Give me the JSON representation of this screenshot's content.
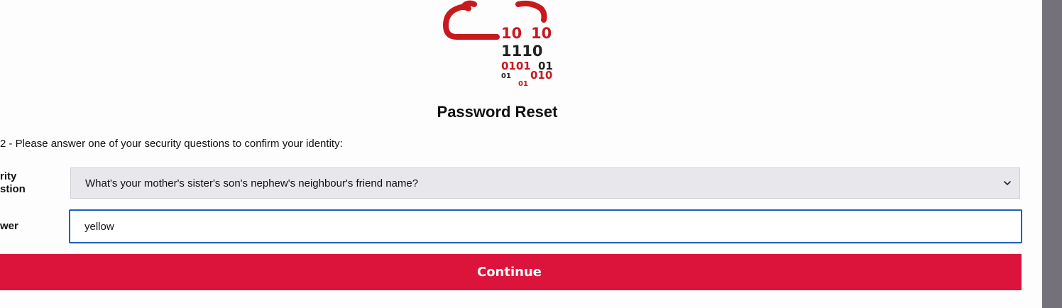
{
  "logo": {
    "binary_lines": [
      "10",
      "10",
      "1110",
      "0101",
      "01",
      "01",
      "010",
      "01"
    ],
    "colors": {
      "primary_red": "#c8191e",
      "dark": "#222222"
    }
  },
  "title": "Password Reset",
  "step_text": "2 - Please answer one of your security questions to confirm your identity:",
  "form": {
    "question_label": "rity\nstion",
    "question_selected": "What's your mother's sister's son's nephew's neighbour's friend name?",
    "answer_label": "wer",
    "answer_value": "yellow"
  },
  "continue_label": "Continue",
  "colors": {
    "button": "#dc143c",
    "focus_border": "#1e5fbf",
    "select_bg": "#e8e8ec",
    "scrollbar": "#74717b"
  }
}
